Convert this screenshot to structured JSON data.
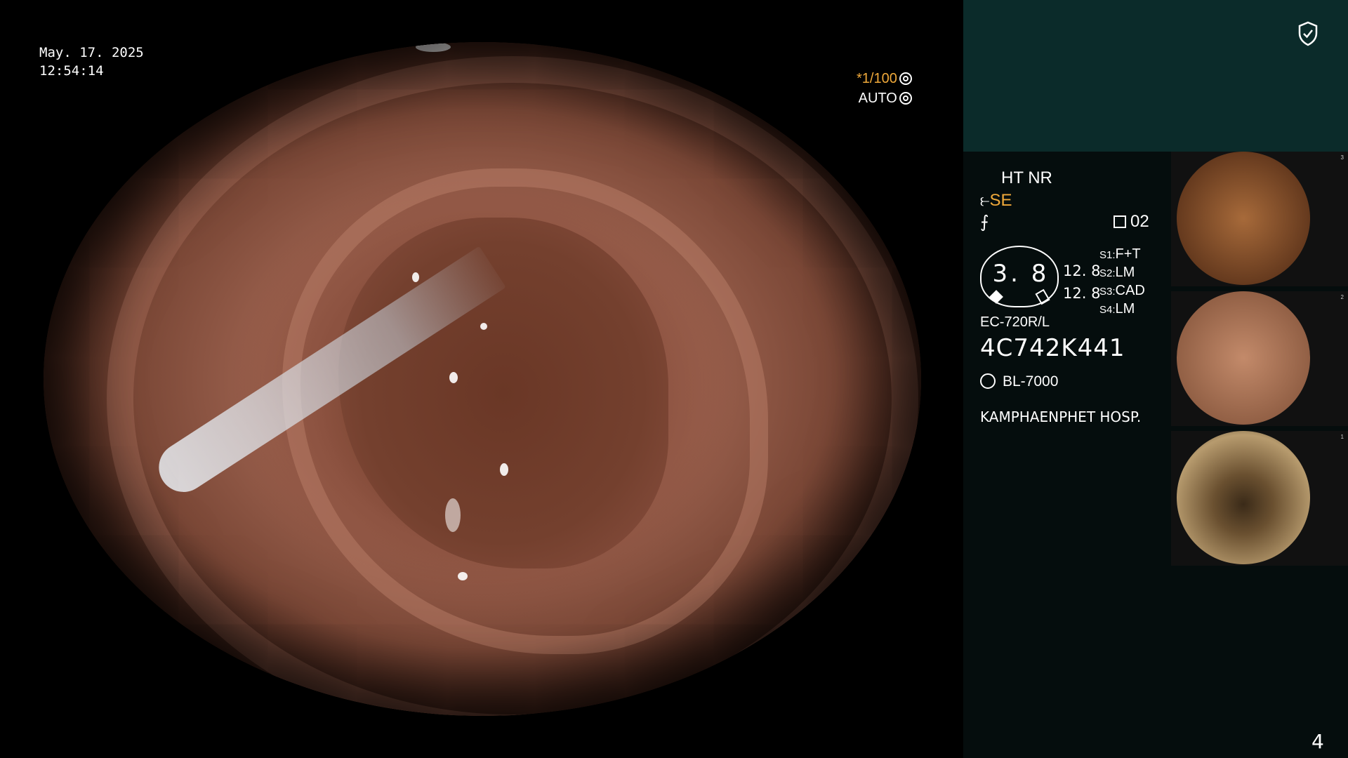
{
  "overlay": {
    "date": "May. 17. 2025",
    "time": "12:54:14",
    "shutter": "*1/100",
    "exposure_mode": "AUTO"
  },
  "panel": {
    "mode_line1": "HT NR",
    "mode_line2_prefix": "",
    "mode_line2_value": "SE",
    "mode_line3": "⨍",
    "counter": "02",
    "gauge_value": "3. 8",
    "num1": "12. 8",
    "num2": "12. 8",
    "slots": [
      {
        "key": "S1",
        "value": "F+T"
      },
      {
        "key": "S2",
        "value": "LM"
      },
      {
        "key": "S3",
        "value": "CAD"
      },
      {
        "key": "S4",
        "value": "LM"
      }
    ],
    "scope_model": "EC-720R/L",
    "serial": "4C742K441",
    "light_source": "BL-7000",
    "hospital": "KAMPHAENPHET HOSP.",
    "page_number": "4"
  },
  "thumbnails": [
    {
      "label": "4C742K441",
      "index": "3",
      "color": "#a76a3a"
    },
    {
      "label": "4C742K441",
      "index": "2",
      "color": "#c38a6a"
    },
    {
      "label": "4C742K441",
      "index": "1",
      "color": "#b79b6e"
    }
  ],
  "colors": {
    "accent": "#f0a93a",
    "panel_top": "#0b2b2a",
    "panel_bg": "#050d0d"
  }
}
